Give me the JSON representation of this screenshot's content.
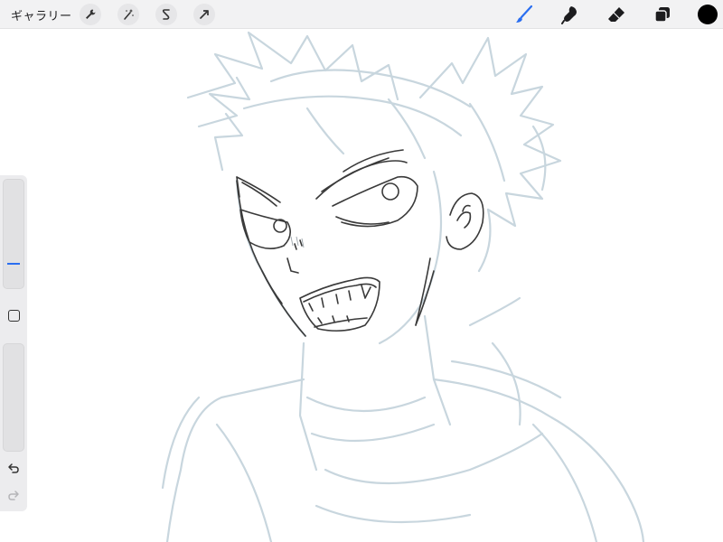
{
  "toolbar": {
    "gallery_label": "ギャラリー",
    "left_icons": [
      "wrench-icon",
      "magic-wand-icon",
      "selection-icon",
      "transform-arrow-icon"
    ],
    "right_icons": [
      "brush-icon",
      "smudge-icon",
      "eraser-icon",
      "layers-icon"
    ],
    "active_tool": "brush",
    "active_color": "#000000",
    "accent_color": "#2a6ef0"
  },
  "sidebar": {
    "brush_size_level": 0.25,
    "opacity_level": 1.0
  },
  "canvas": {
    "background": "#ffffff",
    "sketch_color": "#c8d6de",
    "lineart_color": "#3a3a3a"
  }
}
